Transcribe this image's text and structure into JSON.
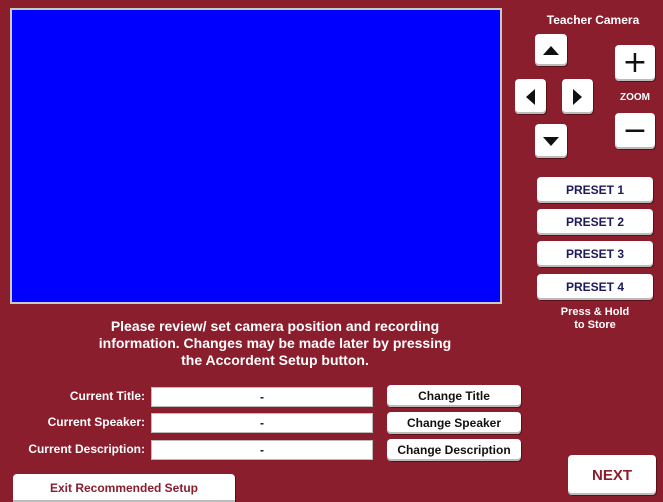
{
  "camera": {
    "title": "Teacher Camera",
    "zoom_label": "ZOOM",
    "zoom_in_glyph": "+",
    "zoom_out_glyph": "−",
    "preview_color": "#0000fe"
  },
  "presets": [
    {
      "label": "PRESET 1"
    },
    {
      "label": "PRESET 2"
    },
    {
      "label": "PRESET 3"
    },
    {
      "label": "PRESET 4"
    }
  ],
  "store_note": [
    "Press & Hold",
    "to Store"
  ],
  "instructions": [
    "Please review/ set camera position and recording",
    "information. Changes may be made later by pressing",
    "the Accordent Setup button."
  ],
  "fields": {
    "title": {
      "label": "Current Title:",
      "value": "-",
      "button": "Change Title"
    },
    "speaker": {
      "label": "Current Speaker:",
      "value": "-",
      "button": "Change Speaker"
    },
    "description": {
      "label": "Current Description:",
      "value": "-",
      "button": "Change Description"
    }
  },
  "footer": {
    "exit_label": "Exit Recommended Setup",
    "next_label": "NEXT"
  },
  "colors": {
    "background": "#8b1e2d",
    "button": "#ffffff",
    "text_light": "#ffffff"
  }
}
